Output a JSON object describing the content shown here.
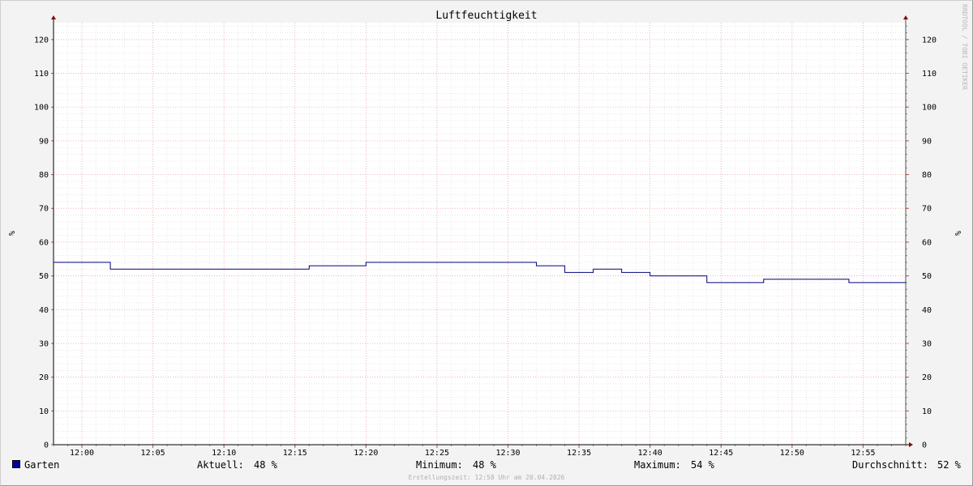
{
  "chart_data": {
    "type": "line",
    "title": "Luftfeuchtigkeit",
    "ylabel": "%",
    "ylim": [
      0,
      125
    ],
    "y_ticks": [
      0,
      10,
      20,
      30,
      40,
      50,
      60,
      70,
      80,
      90,
      100,
      110,
      120
    ],
    "x_tick_labels": [
      "12:00",
      "12:05",
      "12:10",
      "12:15",
      "12:20",
      "12:25",
      "12:30",
      "12:35",
      "12:40",
      "12:45",
      "12:50",
      "12:55"
    ],
    "x_range": [
      "11:58",
      "12:58"
    ],
    "grid": true,
    "line_shape": "step",
    "series": [
      {
        "name": "Garten",
        "color": "#000080",
        "points": [
          [
            "11:58",
            54
          ],
          [
            "12:02",
            52
          ],
          [
            "12:16",
            53
          ],
          [
            "12:20",
            54
          ],
          [
            "12:32",
            53
          ],
          [
            "12:34",
            51
          ],
          [
            "12:36",
            52
          ],
          [
            "12:38",
            51
          ],
          [
            "12:40",
            50
          ],
          [
            "12:44",
            48
          ],
          [
            "12:48",
            49
          ],
          [
            "12:54",
            48
          ],
          [
            "12:58",
            48
          ]
        ]
      }
    ],
    "watermark": "RRDTOOL / TOBI OETIKER"
  },
  "legend": {
    "series_name": "Garten",
    "swatch_color": "#0000a6",
    "current_label": "Aktuell:",
    "current_value": "48 %",
    "min_label": "Minimum:",
    "min_value": "48 %",
    "max_label": "Maximum:",
    "max_value": "54 %",
    "avg_label": "Durchschnitt:",
    "avg_value": "52 %"
  },
  "footer": {
    "created": "Erstellungszeit: 12:58 Uhr am 20.04.2026"
  }
}
